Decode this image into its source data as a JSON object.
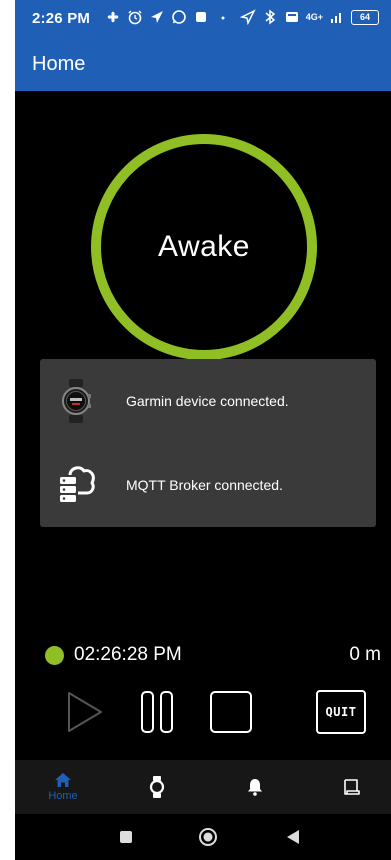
{
  "status_bar": {
    "time": "2:26 PM",
    "network": "4G+",
    "battery": "64"
  },
  "app_bar": {
    "title": "Home"
  },
  "state_ring": {
    "state_label": "Awake",
    "ring_color": "#8fbe25"
  },
  "status_card": {
    "items": [
      {
        "icon": "smartwatch-icon",
        "message": "Garmin device connected."
      },
      {
        "icon": "cloud-server-icon",
        "message": "MQTT Broker connected."
      }
    ]
  },
  "timer": {
    "indicator_color": "#8fbe25",
    "clock": "02:26:28 PM",
    "duration": "0 m"
  },
  "controls": {
    "play_icon": "play-icon",
    "pause_icon": "pause-icon",
    "stop_icon": "stop-icon",
    "quit_label": "QUIT"
  },
  "bottom_nav": {
    "items": [
      {
        "icon": "home-icon",
        "label": "Home",
        "active": true
      },
      {
        "icon": "watch-icon",
        "label": "",
        "active": false
      },
      {
        "icon": "bell-icon",
        "label": "",
        "active": false
      },
      {
        "icon": "script-icon",
        "label": "",
        "active": false
      }
    ],
    "active_color": "#1f5fb6"
  },
  "system_nav": {
    "buttons": [
      "recents-icon",
      "home-circle-icon",
      "back-icon"
    ]
  },
  "colors": {
    "primary": "#1f5fb6",
    "accent": "#8fbe25",
    "background": "#000000",
    "card": "#3a3a3a"
  }
}
